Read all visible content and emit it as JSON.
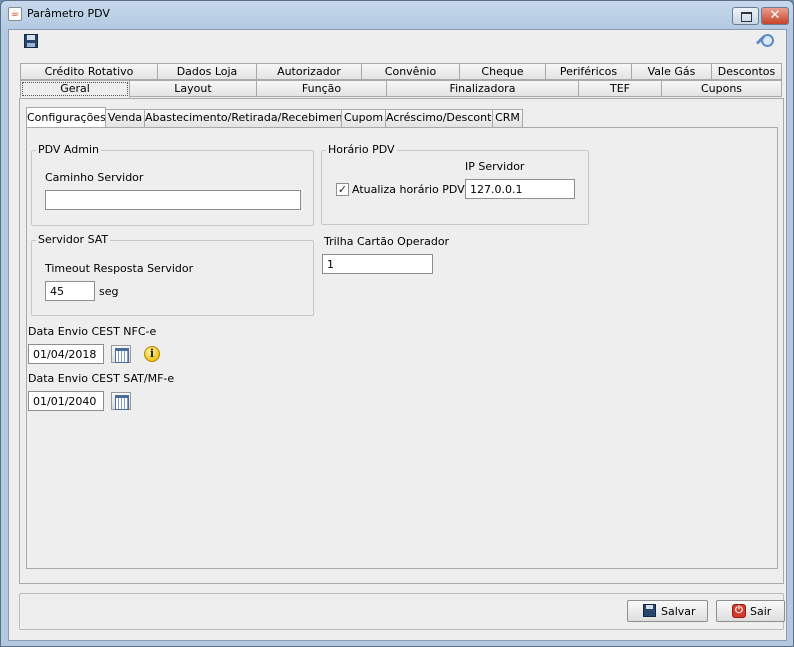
{
  "window": {
    "title": "Parâmetro PDV",
    "close_glyph": "✕"
  },
  "outer_tabs": {
    "row1": [
      "Crédito Rotativo",
      "Dados Loja",
      "Autorizador",
      "Convênio",
      "Cheque",
      "Periféricos",
      "Vale Gás",
      "Descontos"
    ],
    "row2": [
      "Geral",
      "Layout",
      "Função",
      "Finalizadora",
      "TEF",
      "Cupons"
    ],
    "selected": "Geral"
  },
  "inner_tabs": {
    "items": [
      "Configurações",
      "Venda",
      "Abastecimento/Retirada/Recebimento",
      "Cupom",
      "Acréscimo/Desconto",
      "CRM"
    ],
    "selected": "Configurações"
  },
  "pdv_admin": {
    "title": "PDV Admin",
    "caminho_label": "Caminho Servidor",
    "caminho_value": ""
  },
  "horario_pdv": {
    "title": "Horário PDV",
    "checkbox_label": "Atualiza horário PDV",
    "checked": true,
    "ip_label": "IP Servidor",
    "ip_value": "127.0.0.1"
  },
  "servidor_sat": {
    "title": "Servidor SAT",
    "timeout_label": "Timeout Resposta Servidor",
    "timeout_value": "45",
    "unit": "seg"
  },
  "trilha": {
    "label": "Trilha Cartão Operador",
    "value": "1"
  },
  "cest_nfce": {
    "label": "Data Envio CEST NFC-e",
    "value": "01/04/2018"
  },
  "cest_sat": {
    "label": "Data Envio CEST SAT/MF-e",
    "value": "01/01/2040"
  },
  "footer": {
    "save_label": "Salvar",
    "exit_label": "Sair"
  },
  "icons": {
    "check_glyph": "✓",
    "info_glyph": "i",
    "power_glyph": "⏻",
    "app_glyph": "☕"
  }
}
